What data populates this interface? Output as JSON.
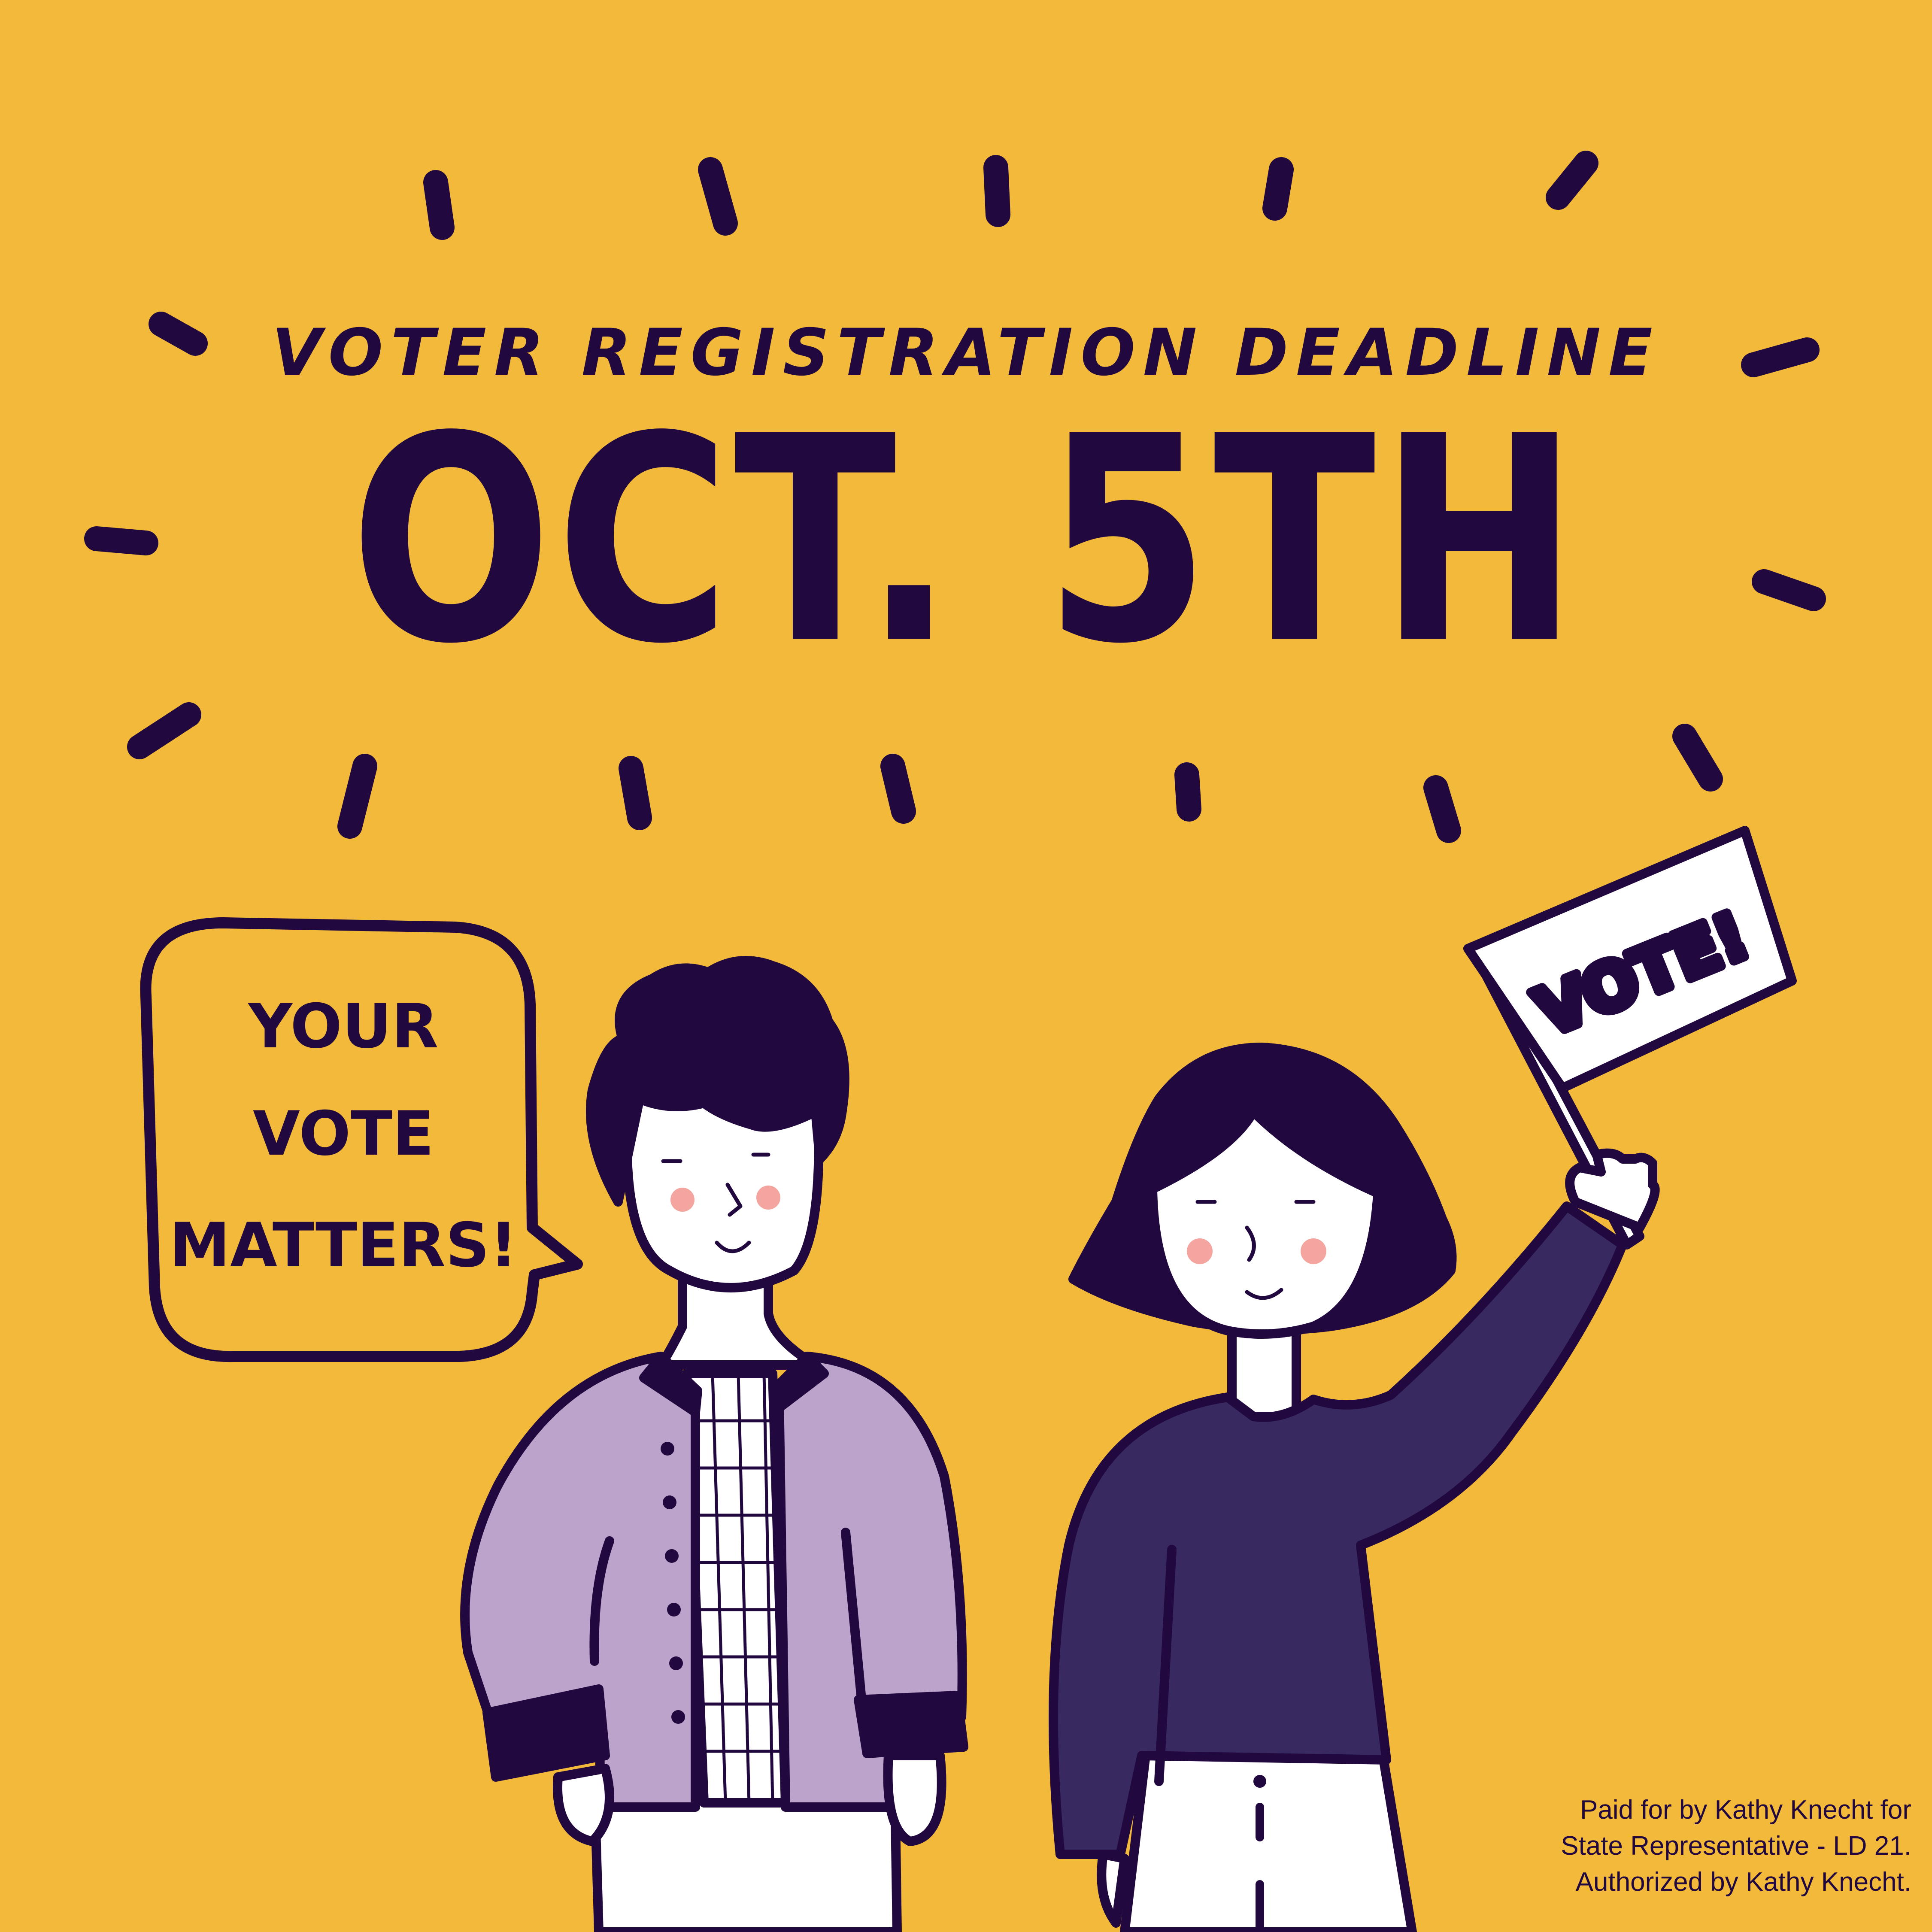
{
  "headline": {
    "subtitle": "VOTER REGISTRATION DEADLINE",
    "date": "OCT. 5TH"
  },
  "speech_bubble": {
    "lines": [
      "YOUR",
      "VOTE",
      "MATTERS!"
    ]
  },
  "flag": {
    "text": "VOTE!"
  },
  "disclaimer": {
    "lines": [
      "Paid for by Kathy Knecht for",
      "State Representative - LD 21.",
      "Authorized by Kathy Knecht."
    ]
  },
  "colors": {
    "background": "#f3b93b",
    "ink": "#21083e",
    "jacket": "#bca3cc",
    "sweater": "#382a61",
    "cheek": "#f4a5a0",
    "white": "#ffffff"
  }
}
